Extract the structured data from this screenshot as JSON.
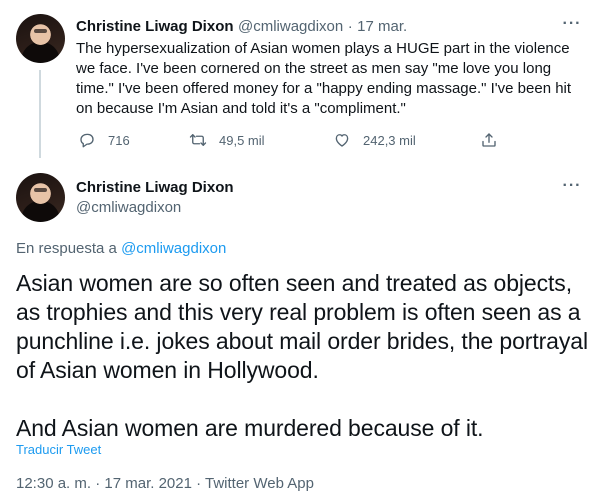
{
  "colors": {
    "link": "#1d9bf0",
    "muted": "#536471",
    "text": "#0f1419",
    "thread_line": "#cfd9de"
  },
  "tweet1": {
    "name": "Christine Liwag Dixon",
    "handle": "@cmliwagdixon",
    "separator": "·",
    "date": "17 mar.",
    "more_icon": "more-icon",
    "text": "The hypersexualization of Asian women plays a HUGE part in the violence we face. I've been cornered on the street as men say \"me love you long time.\" I've been offered money for a \"happy ending massage.\" I've been hit on because I'm Asian and told it's a \"compliment.\"",
    "actions": {
      "reply_count": "716",
      "retweet_count": "49,5 mil",
      "like_count": "242,3 mil"
    }
  },
  "tweet2": {
    "name": "Christine Liwag Dixon",
    "handle": "@cmliwagdixon",
    "reply_prefix": "En respuesta a ",
    "reply_mention": "@cmliwagdixon",
    "paragraph1": "Asian women are so often seen and treated as objects, as trophies and this very real problem is often seen as a punchline i.e. jokes about mail order brides, the portrayal of Asian women in Hollywood.",
    "paragraph2": "And Asian women are murdered because of it.",
    "translate": "Traducir Tweet",
    "meta": "12:30 a. m. · 17 mar. 2021 · Twitter Web App"
  }
}
